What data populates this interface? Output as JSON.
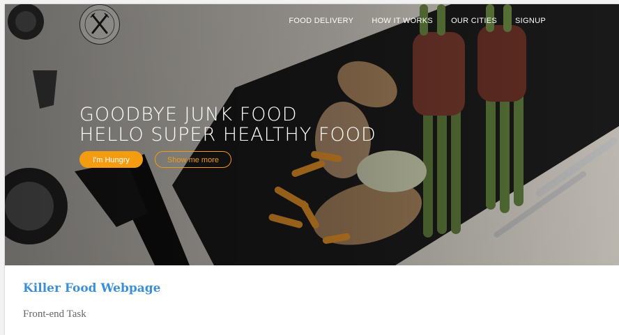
{
  "nav": {
    "items": [
      {
        "label": "FOOD DELIVERY"
      },
      {
        "label": "HOW IT WORKS"
      },
      {
        "label": "OUR CITIES"
      },
      {
        "label": "SIGNUP"
      }
    ]
  },
  "hero": {
    "headline_line1": "GOODBYE JUNK FOOD",
    "headline_line2": "HELLO SUPER HEALTHY FOOD",
    "primary_button": "I'm Hungry",
    "secondary_button": "Show me more"
  },
  "info": {
    "title": "Killer Food Webpage",
    "subtitle": "Front-end Task"
  },
  "colors": {
    "accent": "#f39c12",
    "title_blue": "#3b8fd8",
    "subtitle_gray": "#666666"
  },
  "icons": {
    "logo": "fork-and-knife-logo"
  }
}
